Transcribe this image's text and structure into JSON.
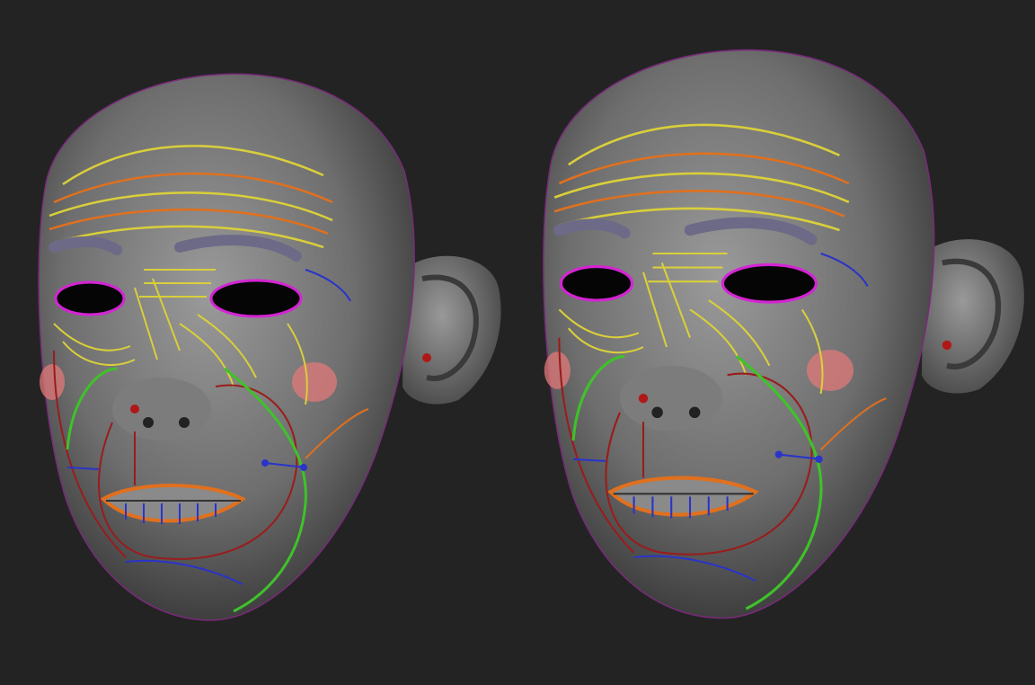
{
  "scene": {
    "background": "#232323",
    "subject_count": 2,
    "line_colors": {
      "yellow": "#d9cf3a",
      "orange": "#e0701e",
      "red": "#9a1c1c",
      "green": "#3fc22a",
      "blue": "#2a34c8",
      "magenta": "#d424d4",
      "cheek": "#e07a78",
      "brow": "#6c6a86"
    }
  }
}
